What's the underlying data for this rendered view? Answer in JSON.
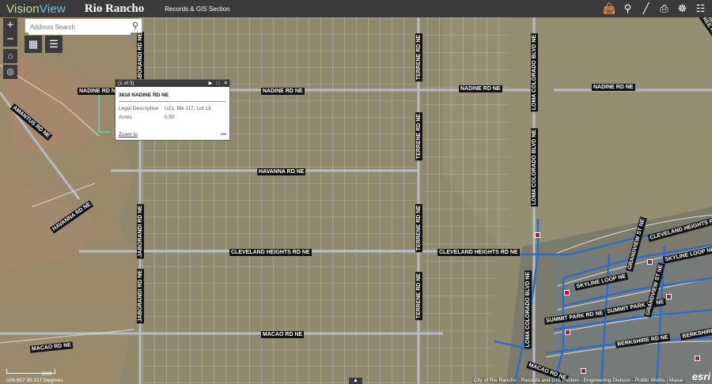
{
  "header": {
    "logo_part1": "Vision",
    "logo_part2": "View",
    "city": "Rio Rancho",
    "section": "Records & GIS Section",
    "icons": [
      "bag-icon",
      "search-icon",
      "ruler-icon",
      "print-icon",
      "share-icon",
      "grid-icon"
    ]
  },
  "search": {
    "placeholder": "Address Search"
  },
  "controls": {
    "zoom_in": "+",
    "zoom_out": "−"
  },
  "popup": {
    "counter": "(1 of 3)",
    "title": "3618 NADINE RD NE",
    "fields": [
      {
        "key": "Legal Description",
        "value": "U21, Blk 117, Lot 13"
      },
      {
        "key": "Acres",
        "value": "0.50"
      }
    ],
    "zoom_link": "Zoom to",
    "more": "•••"
  },
  "roads": {
    "nadine_left": "NADINE RD NE",
    "nadine_mid": "NADINE RD NE",
    "nadine_right": "NADINE RD NE",
    "amantus": "AMANTUS RD NE",
    "havanna_left": "HAVANNA RD NE",
    "havanna_mid": "HAVANNA RD NE",
    "cleveland_mid": "CLEVELAND HEIGHTS RD NE",
    "cleveland_right": "CLEVELAND HEIGHTS RD NE",
    "cleveland_far": "CLEVELAND HEIGHTS RD NE",
    "macao_left": "MACAO RD NE",
    "macao_mid": "MACAO RD NE",
    "macao_right": "MACAO RD NE",
    "jaborandi": "JABORANDI RD NE",
    "terrene": "TERRENE RD NE",
    "loma": "LOMA COLORADO BLVD NE",
    "skyline": "SKYLINE LOOP NE",
    "summit": "SUMMIT PARK RD NE",
    "berkshire": "BERKSHIRE RD NE",
    "grandview": "GRANDVIEW ST NE",
    "tyree": "TYREE RD NE"
  },
  "footer": {
    "coords": "-106.657 35.317 Degrees",
    "scale": "300ft",
    "attribution": "City of Rio Rancho - Records and GIS Section - Engineering Division - Public Works | Maxar",
    "esri": "esri",
    "collapse": "▲"
  },
  "colors": {
    "topbar": "#3a3a3a",
    "desert": "#8f8a6c",
    "parcel_line": "#d9dde6",
    "road_line": "#b7bcc5",
    "water_line": "#2f6cc9",
    "marker": "#b01c2e"
  }
}
